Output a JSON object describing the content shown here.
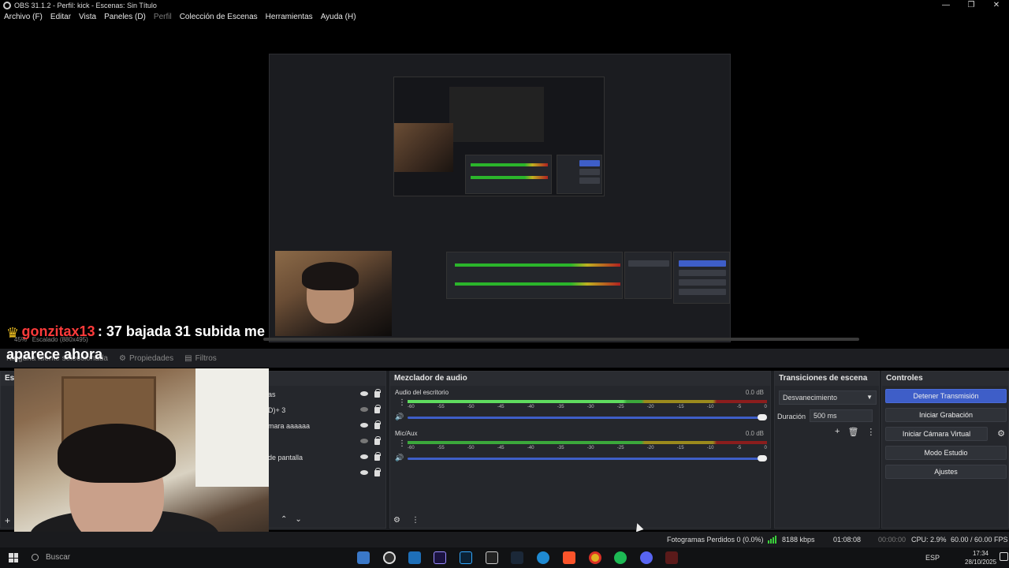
{
  "window": {
    "title": "OBS 31.1.2 - Perfil: kick - Escenas: Sin Título",
    "controls": [
      "—",
      "❐",
      "✕"
    ]
  },
  "menu": {
    "items": [
      "Archivo (F)",
      "Editar",
      "Vista",
      "Paneles (D)",
      "Perfil",
      "Colección de Escenas",
      "Herramientas",
      "Ayuda (H)"
    ]
  },
  "preview": {
    "zoom_label": "45%",
    "scale_label": "Escalado (880x495)",
    "chat": {
      "username": "gonzitax13",
      "message": ": 37 bajada 31 subida me",
      "message_line2": "aparece ahora"
    }
  },
  "source_toolbar": {
    "no_source": "Ninguna fuente seleccionada",
    "properties": "Propiedades",
    "filters": "Filtros"
  },
  "scenes_panel": {
    "header": "Esc",
    "sources": [
      {
        "label": "as"
      },
      {
        "label": "D)+ 3"
      },
      {
        "label": "mara aaaaaa"
      },
      {
        "label": ""
      },
      {
        "label": "de pantalla"
      },
      {
        "label": ""
      }
    ]
  },
  "mixer": {
    "header": "Mezclador de audio",
    "tracks": [
      {
        "name": "Audio del escritorio",
        "db": "0.0 dB"
      },
      {
        "name": "Mic/Aux",
        "db": "0.0 dB"
      }
    ],
    "ticks": [
      "-60",
      "-55",
      "-50",
      "-45",
      "-40",
      "-35",
      "-30",
      "-25",
      "-20",
      "-15",
      "-10",
      "-5",
      "0"
    ]
  },
  "transitions": {
    "header": "Transiciones de escena",
    "selected": "Desvanecimiento",
    "duration_label": "Duración",
    "duration_value": "500 ms"
  },
  "controls": {
    "header": "Controles",
    "stop_stream": "Detener Transmisión",
    "start_recording": "Iniciar Grabación",
    "virtual_cam": "Iniciar Cámara Virtual",
    "studio_mode": "Modo Estudio",
    "settings": "Ajustes"
  },
  "status": {
    "dropped_frames": "Fotogramas Perdidos 0 (0.0%)",
    "bitrate": "8188 kbps",
    "stream_time": "01:08:08",
    "rec_time": "00:00:00",
    "cpu": "CPU: 2.9%",
    "fps": "60.00 / 60.00 FPS"
  },
  "taskbar": {
    "search_placeholder": "Buscar",
    "language": "ESP",
    "time": "17:34",
    "date": "28/10/2025"
  }
}
